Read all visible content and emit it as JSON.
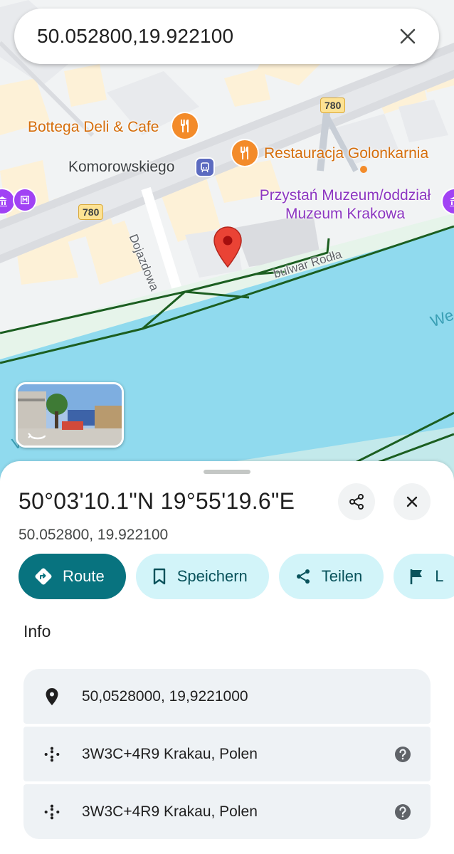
{
  "search": {
    "query": "50.052800,19.922100"
  },
  "map": {
    "poi_bottega": "Bottega Deli & Cafe",
    "poi_restauracja": "Restauracja Golonkarnia",
    "poi_komorowskiego": "Komorowskiego",
    "poi_museum_line1": "Przystań Muzeum/oddział",
    "poi_museum_line2": "Muzeum Krakowa",
    "street_dojazdowa": "Dojazdowa",
    "street_bulwar": "bulwar Rodła",
    "road_shield_top": "780",
    "road_shield_left": "780",
    "water_right": "We",
    "water_left": "W"
  },
  "place": {
    "title": "50°03'10.1\"N 19°55'19.6\"E",
    "coords": "50.052800, 19.922100"
  },
  "actions": [
    {
      "label": "Route",
      "icon": "directions-icon"
    },
    {
      "label": "Speichern",
      "icon": "bookmark-icon"
    },
    {
      "label": "Teilen",
      "icon": "share-icon"
    },
    {
      "label": "L",
      "icon": "flag-icon"
    }
  ],
  "info": {
    "title": "Info",
    "rows": [
      {
        "text": "50,0528000, 19,9221000",
        "icon": "pin-icon"
      },
      {
        "text": "3W3C+4R9 Krakau, Polen",
        "icon": "plus-code-icon"
      },
      {
        "text": "3W3C+4R9 Krakau, Polen",
        "icon": "plus-code-icon"
      }
    ]
  },
  "colors": {
    "accent": "#08737f",
    "tonal_chip": "#d2f4f9",
    "water": "#90daee",
    "pin": "#ea4335",
    "restaurant": "#f38b2a",
    "museum": "#a142f4"
  }
}
